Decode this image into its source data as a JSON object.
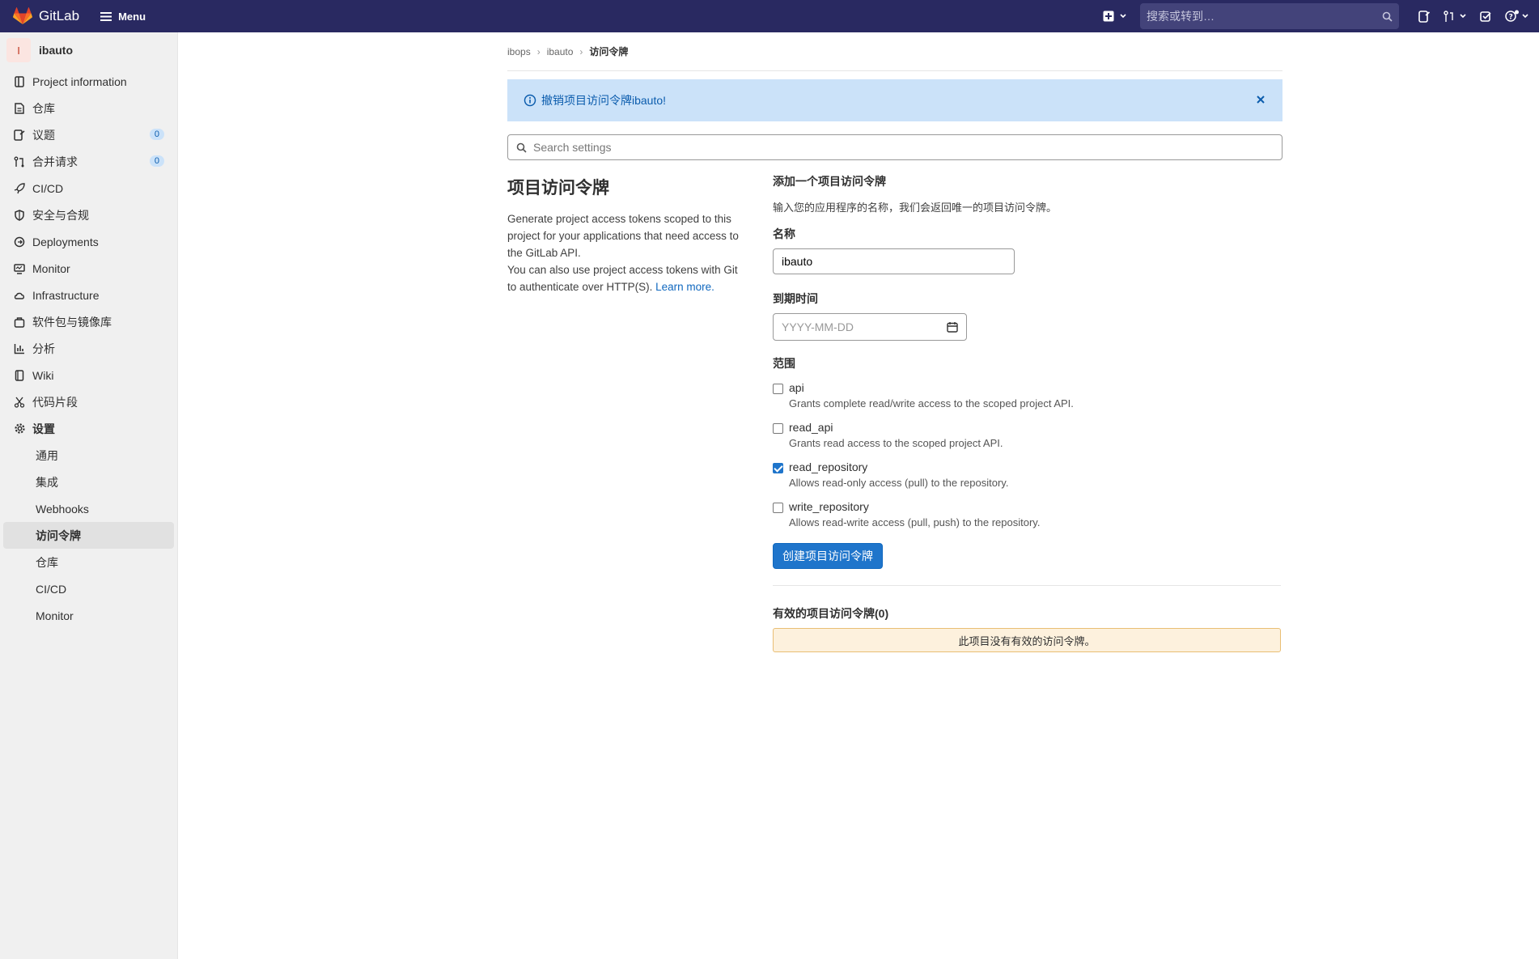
{
  "topbar": {
    "brand": "GitLab",
    "menu_label": "Menu",
    "search_placeholder": "搜索或转到…"
  },
  "sidebar": {
    "project_initial": "I",
    "project_name": "ibauto",
    "items": [
      {
        "label": "Project information",
        "icon": "project-info-icon"
      },
      {
        "label": "仓库",
        "icon": "repository-icon"
      },
      {
        "label": "议题",
        "icon": "issues-icon",
        "badge": "0"
      },
      {
        "label": "合并请求",
        "icon": "merge-request-icon",
        "badge": "0"
      },
      {
        "label": "CI/CD",
        "icon": "rocket-icon"
      },
      {
        "label": "安全与合规",
        "icon": "shield-icon"
      },
      {
        "label": "Deployments",
        "icon": "deployments-icon"
      },
      {
        "label": "Monitor",
        "icon": "monitor-icon"
      },
      {
        "label": "Infrastructure",
        "icon": "cloud-icon"
      },
      {
        "label": "软件包与镜像库",
        "icon": "package-icon"
      },
      {
        "label": "分析",
        "icon": "chart-icon"
      },
      {
        "label": "Wiki",
        "icon": "book-icon"
      },
      {
        "label": "代码片段",
        "icon": "scissors-icon"
      },
      {
        "label": "设置",
        "icon": "gear-icon"
      }
    ],
    "settings_sub": [
      "通用",
      "集成",
      "Webhooks",
      "访问令牌",
      "仓库",
      "CI/CD",
      "Monitor"
    ]
  },
  "breadcrumb": [
    "ibops",
    "ibauto",
    "访问令牌"
  ],
  "alert": {
    "text": "撤销项目访问令牌ibauto!"
  },
  "search_settings": {
    "placeholder": "Search settings"
  },
  "left": {
    "title": "项目访问令牌",
    "desc1": "Generate project access tokens scoped to this project for your applications that need access to the GitLab API.",
    "desc2": "You can also use project access tokens with Git to authenticate over HTTP(S).",
    "learn_more": "Learn more."
  },
  "form": {
    "heading": "添加一个项目访问令牌",
    "hint": "输入您的应用程序的名称，我们会返回唯一的项目访问令牌。",
    "name_label": "名称",
    "name_value": "ibauto",
    "expiry_label": "到期时间",
    "expiry_placeholder": "YYYY-MM-DD",
    "scope_label": "范围",
    "scopes": [
      {
        "name": "api",
        "desc": "Grants complete read/write access to the scoped project API.",
        "checked": false
      },
      {
        "name": "read_api",
        "desc": "Grants read access to the scoped project API.",
        "checked": false
      },
      {
        "name": "read_repository",
        "desc": "Allows read-only access (pull) to the repository.",
        "checked": true
      },
      {
        "name": "write_repository",
        "desc": "Allows read-write access (pull, push) to the repository.",
        "checked": false
      }
    ],
    "submit": "创建项目访问令牌"
  },
  "active": {
    "heading": "有效的项目访问令牌(0)",
    "empty": "此项目没有有效的访问令牌。"
  }
}
